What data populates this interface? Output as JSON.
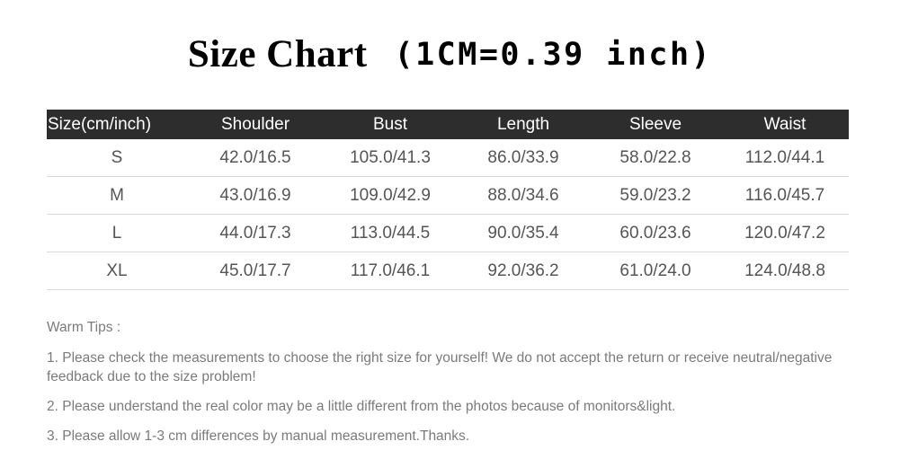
{
  "title": {
    "main": "Size Chart",
    "conversion": "(1CM=0.39 inch)"
  },
  "table": {
    "columns": [
      "Size(cm/inch)",
      "Shoulder",
      "Bust",
      "Length",
      "Sleeve",
      "Waist"
    ],
    "rows": [
      {
        "size": "S",
        "shoulder": "42.0/16.5",
        "bust": "105.0/41.3",
        "length": "86.0/33.9",
        "sleeve": "58.0/22.8",
        "waist": "112.0/44.1"
      },
      {
        "size": "M",
        "shoulder": "43.0/16.9",
        "bust": "109.0/42.9",
        "length": "88.0/34.6",
        "sleeve": "59.0/23.2",
        "waist": "116.0/45.7"
      },
      {
        "size": "L",
        "shoulder": "44.0/17.3",
        "bust": "113.0/44.5",
        "length": "90.0/35.4",
        "sleeve": "60.0/23.6",
        "waist": "120.0/47.2"
      },
      {
        "size": "XL",
        "shoulder": "45.0/17.7",
        "bust": "117.0/46.1",
        "length": "92.0/36.2",
        "sleeve": "61.0/24.0",
        "waist": "124.0/48.8"
      }
    ]
  },
  "tips": {
    "heading": "Warm Tips :",
    "items": [
      "1. Please check the measurements to choose the right size for yourself! We do not accept the return or receive neutral/negative feedback due to the size problem!",
      "2. Please understand the real color may be a little different from the photos because of monitors&light.",
      "3. Please allow 1-3 cm differences by manual measurement.Thanks."
    ]
  },
  "colors": {
    "header_bar": "#2d2d2d",
    "header_text": "#ffffff",
    "cell_text": "#555555",
    "tips_text": "#7b7b7b",
    "row_border": "#d9d9d9",
    "background": "#ffffff"
  }
}
